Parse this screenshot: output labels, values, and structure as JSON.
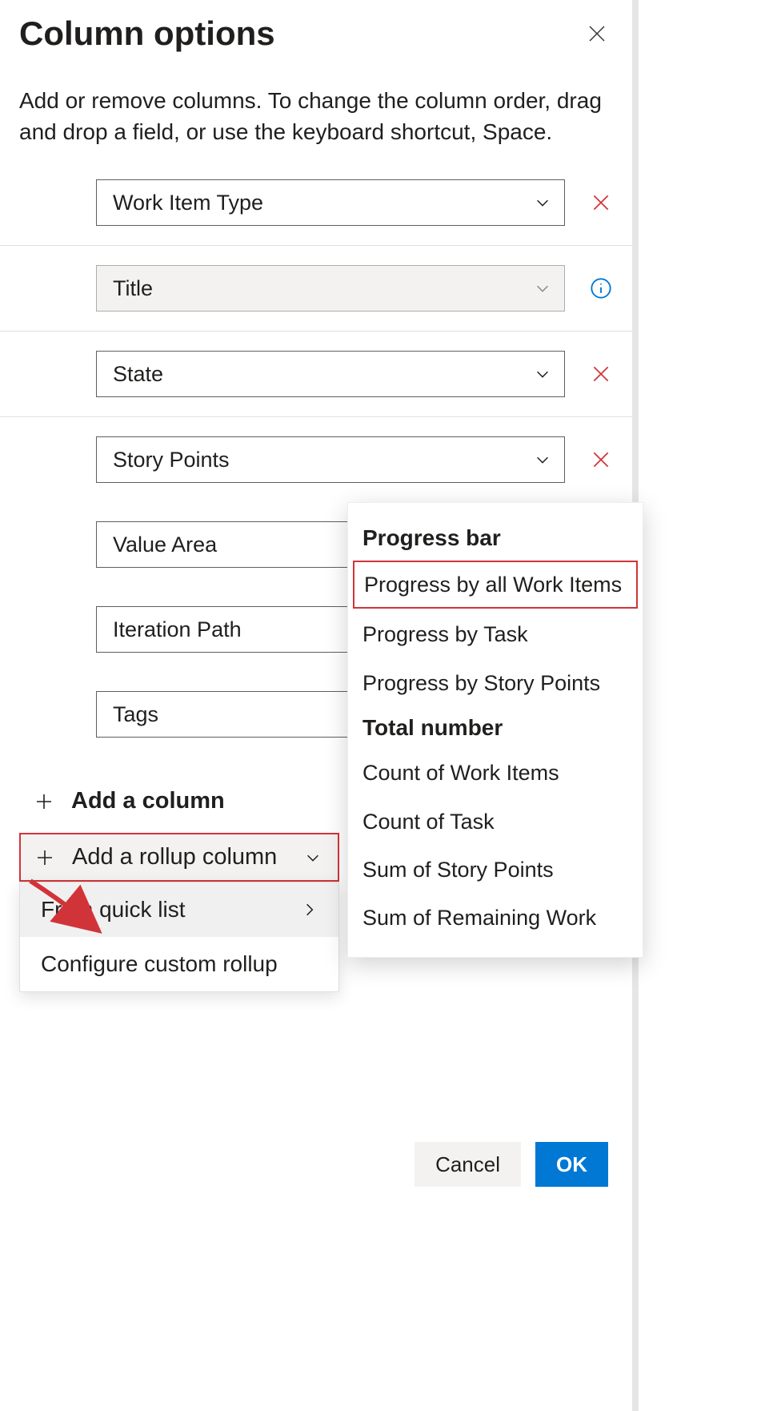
{
  "header": {
    "title": "Column options"
  },
  "description": "Add or remove columns. To change the column order, drag and drop a field, or use the keyboard shortcut, Space.",
  "columns": [
    {
      "label": "Work Item Type",
      "action": "remove",
      "readonly": false
    },
    {
      "label": "Title",
      "action": "info",
      "readonly": true
    },
    {
      "label": "State",
      "action": "remove",
      "readonly": false
    },
    {
      "label": "Story Points",
      "action": "remove",
      "readonly": false
    },
    {
      "label": "Value Area",
      "action": "remove",
      "readonly": false
    },
    {
      "label": "Iteration Path",
      "action": "remove",
      "readonly": false
    },
    {
      "label": "Tags",
      "action": "remove",
      "readonly": false
    }
  ],
  "actions": {
    "add_column_label": "Add a column",
    "add_rollup_label": "Add a rollup column"
  },
  "rollup_submenu": {
    "from_quick_list": "From quick list",
    "configure_custom": "Configure custom rollup"
  },
  "flyout": {
    "section1_header": "Progress bar",
    "section1_items": [
      "Progress by all Work Items",
      "Progress by Task",
      "Progress by Story Points"
    ],
    "section2_header": "Total number",
    "section2_items": [
      "Count of Work Items",
      "Count of Task",
      "Sum of Story Points",
      "Sum of Remaining Work"
    ]
  },
  "footer": {
    "cancel": "Cancel",
    "ok": "OK"
  }
}
